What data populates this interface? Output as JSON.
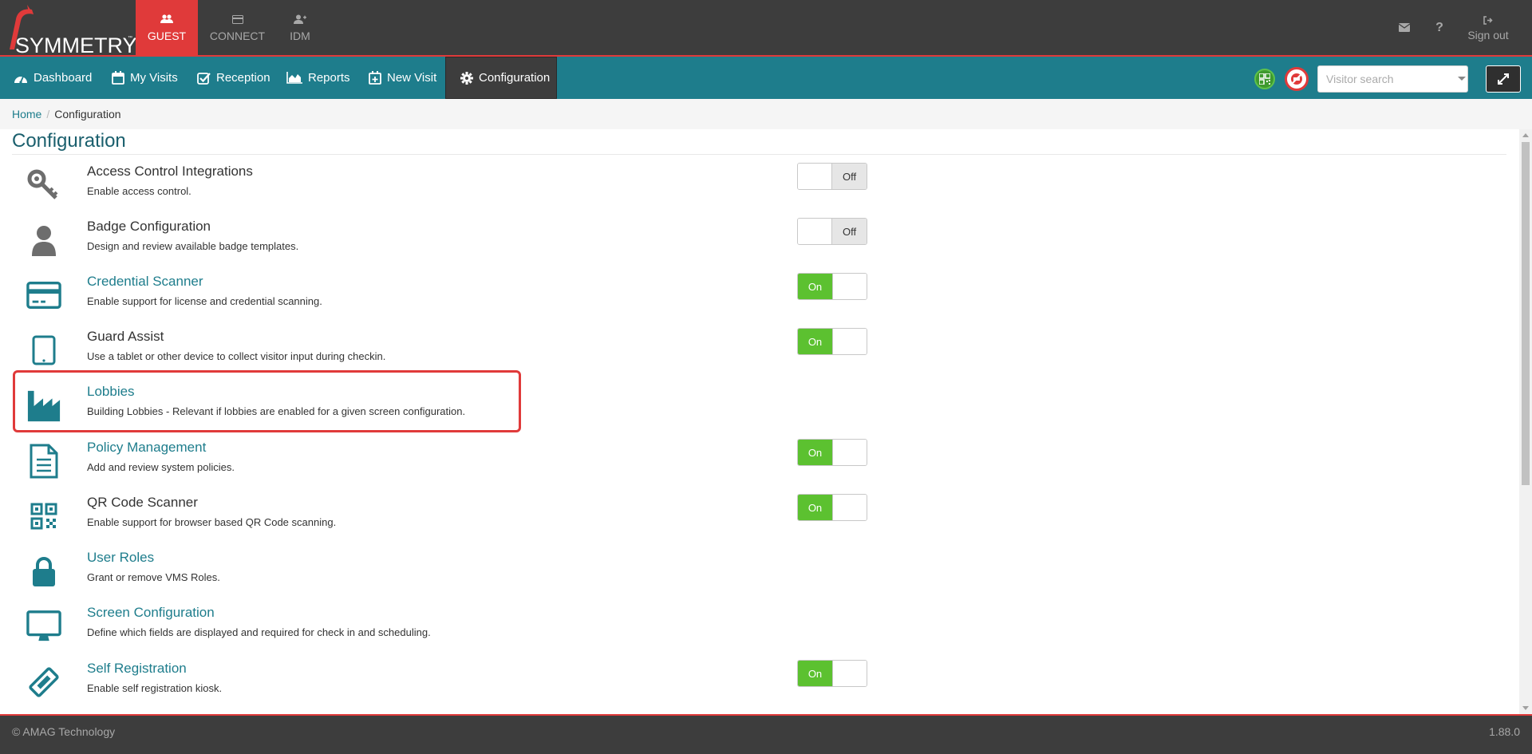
{
  "brand": {
    "name": "SYMMETRY",
    "tm": "™"
  },
  "app_tabs": [
    {
      "label": "GUEST",
      "icon": "users-icon",
      "active": true
    },
    {
      "label": "CONNECT",
      "icon": "card-icon",
      "active": false
    },
    {
      "label": "IDM",
      "icon": "user-plus-icon",
      "active": false
    }
  ],
  "top_actions": {
    "mail_icon": "envelope-icon",
    "help_label": "?",
    "signout_label": "Sign out"
  },
  "nav": [
    {
      "label": "Dashboard",
      "icon": "dashboard-icon"
    },
    {
      "label": "My Visits",
      "icon": "calendar-icon"
    },
    {
      "label": "Reception",
      "icon": "checkbox-icon"
    },
    {
      "label": "Reports",
      "icon": "area-chart-icon"
    },
    {
      "label": "New Visit",
      "icon": "calendar-plus-icon"
    },
    {
      "label": "Configuration",
      "icon": "gear-icon",
      "active": true
    }
  ],
  "search": {
    "placeholder": "Visitor search"
  },
  "breadcrumb": {
    "home": "Home",
    "separator": "/",
    "current": "Configuration"
  },
  "page_title": "Configuration",
  "items": [
    {
      "title": "Access Control Integrations",
      "desc": "Enable access control.",
      "icon": "key-icon",
      "link": false,
      "toggle": "Off"
    },
    {
      "title": "Badge Configuration",
      "desc": "Design and review available badge templates.",
      "icon": "user-icon",
      "link": false,
      "toggle": "Off"
    },
    {
      "title": "Credential Scanner",
      "desc": "Enable support for license and credential scanning.",
      "icon": "credit-card-icon",
      "link": true,
      "toggle": "On"
    },
    {
      "title": "Guard Assist",
      "desc": "Use a tablet or other device to collect visitor input during checkin.",
      "icon": "tablet-icon",
      "link": false,
      "toggle": "On"
    },
    {
      "title": "Lobbies",
      "desc": "Building Lobbies - Relevant if lobbies are enabled for a given screen configuration.",
      "icon": "factory-icon",
      "link": true,
      "toggle": null
    },
    {
      "title": "Policy Management",
      "desc": "Add and review system policies.",
      "icon": "document-icon",
      "link": true,
      "toggle": "On"
    },
    {
      "title": "QR Code Scanner",
      "desc": "Enable support for browser based QR Code scanning.",
      "icon": "qrcode-icon",
      "link": false,
      "toggle": "On"
    },
    {
      "title": "User Roles",
      "desc": "Grant or remove VMS Roles.",
      "icon": "lock-icon",
      "link": true,
      "toggle": null
    },
    {
      "title": "Screen Configuration",
      "desc": "Define which fields are displayed and required for check in and scheduling.",
      "icon": "monitor-icon",
      "link": true,
      "toggle": null
    },
    {
      "title": "Self Registration",
      "desc": "Enable self registration kiosk.",
      "icon": "ticket-icon",
      "link": true,
      "toggle": "On"
    }
  ],
  "colors": {
    "accent": "#1e7d8c",
    "brand_red": "#e03a3a",
    "toggle_on": "#5cc130",
    "dark": "#3d3d3d"
  },
  "footer": {
    "copyright": "© AMAG Technology",
    "version": "1.88.0"
  }
}
